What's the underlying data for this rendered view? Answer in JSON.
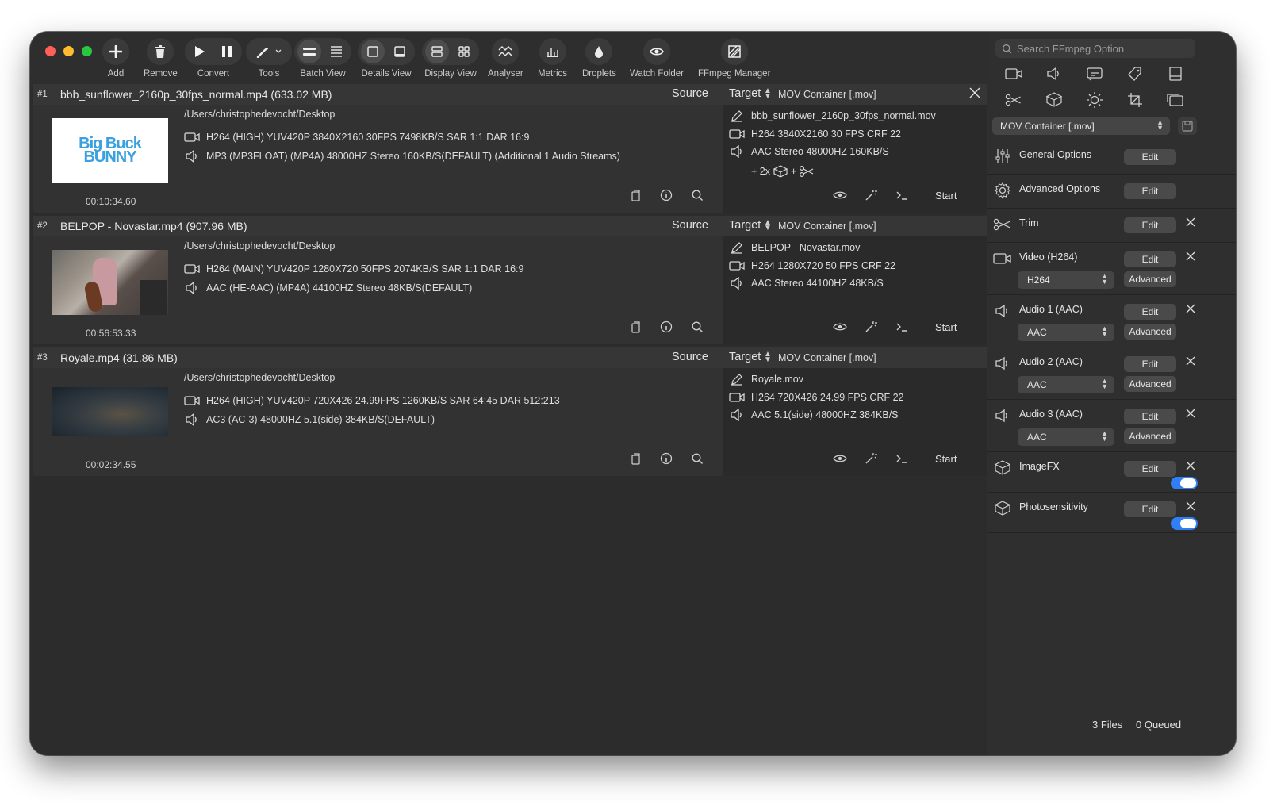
{
  "toolbar": {
    "items": [
      {
        "label": "Add",
        "icon": "plus-icon"
      },
      {
        "label": "Remove",
        "icon": "trash-icon"
      },
      {
        "label": "Convert",
        "icons": [
          "play-icon",
          "pause-icon"
        ]
      },
      {
        "label": "Tools",
        "icon": "wand-icon"
      },
      {
        "label": "Batch View",
        "icons": [
          "batch-list-icon",
          "batch-detail-list-icon"
        ]
      },
      {
        "label": "Details View",
        "icons": [
          "details-view-icon",
          "details-view-alt-icon"
        ]
      },
      {
        "label": "Display View",
        "icons": [
          "rows-icon",
          "grid-icon"
        ]
      },
      {
        "label": "Analyser",
        "icon": "analyser-icon"
      },
      {
        "label": "Metrics",
        "icon": "metrics-icon"
      },
      {
        "label": "Droplets",
        "icon": "droplet-icon"
      },
      {
        "label": "Watch Folder",
        "icon": "eye-icon"
      },
      {
        "label": "FFmpeg Manager",
        "icon": "ffmpeg-icon"
      }
    ]
  },
  "jobs": [
    {
      "number": "#1",
      "title": "bbb_sunflower_2160p_30fps_normal.mp4  (633.02 MB)",
      "source_label": "Source",
      "target_label": "Target",
      "target_container": "MOV Container [.mov]",
      "path": "/Users/christophedevocht/Desktop",
      "video_stream": "H264 (HIGH) YUV420P 3840X2160  30FPS 7498KB/S SAR 1:1 DAR 16:9",
      "audio_stream": "MP3 (MP3FLOAT) (MP4A) 48000HZ Stereo 160KB/S(DEFAULT) (Additional 1 Audio Streams)",
      "duration": "00:10:34.60",
      "thumb_text": "Big Buck BUNNY",
      "target_filename": "bbb_sunflower_2160p_30fps_normal.mov",
      "target_video": "H264 3840X2160 30 FPS CRF 22",
      "target_audio": "AAC Stereo 48000HZ 160KB/S",
      "target_extra": "+ 2x",
      "target_extra_plus": "+",
      "start_label": "Start"
    },
    {
      "number": "#2",
      "title": "BELPOP  - Novastar.mp4  (907.96 MB)",
      "source_label": "Source",
      "target_label": "Target",
      "target_container": "MOV Container [.mov]",
      "path": "/Users/christophedevocht/Desktop",
      "video_stream": "H264 (MAIN) YUV420P 1280X720  50FPS 2074KB/S SAR 1:1 DAR 16:9",
      "audio_stream": "AAC (HE-AAC) (MP4A) 44100HZ Stereo 48KB/S(DEFAULT)",
      "duration": "00:56:53.33",
      "target_filename": "BELPOP  - Novastar.mov",
      "target_video": "H264 1280X720 50 FPS CRF 22",
      "target_audio": "AAC Stereo 44100HZ 48KB/S",
      "start_label": "Start"
    },
    {
      "number": "#3",
      "title": "Royale.mp4  (31.86 MB)",
      "source_label": "Source",
      "target_label": "Target",
      "target_container": "MOV Container [.mov]",
      "path": "/Users/christophedevocht/Desktop",
      "video_stream": "H264 (HIGH) YUV420P 720X426  24.99FPS 1260KB/S SAR 64:45 DAR 512:213",
      "audio_stream": "AC3 (AC-3) 48000HZ 5.1(side) 384KB/S(DEFAULT)",
      "duration": "00:02:34.55",
      "target_filename": "Royale.mov",
      "target_video": "H264 720X426 24.99 FPS CRF 22",
      "target_audio": "AAC 5.1(side) 48000HZ 384KB/S",
      "start_label": "Start"
    }
  ],
  "sidebar": {
    "search_placeholder": "Search FFmpeg Option",
    "container_select": "MOV Container [.mov]",
    "sections": [
      {
        "title": "General Options",
        "edit": "Edit"
      },
      {
        "title": "Advanced Options",
        "edit": "Edit"
      },
      {
        "title": "Trim",
        "edit": "Edit"
      },
      {
        "title": "Video (H264)",
        "edit": "Edit",
        "codec": "H264",
        "advanced": "Advanced"
      },
      {
        "title": "Audio 1 (AAC)",
        "edit": "Edit",
        "codec": "AAC",
        "advanced": "Advanced"
      },
      {
        "title": "Audio 2 (AAC)",
        "edit": "Edit",
        "codec": "AAC",
        "advanced": "Advanced"
      },
      {
        "title": "Audio 3 (AAC)",
        "edit": "Edit",
        "codec": "AAC",
        "advanced": "Advanced"
      },
      {
        "title": "ImageFX",
        "edit": "Edit",
        "enabled": true
      },
      {
        "title": "Photosensitivity",
        "edit": "Edit",
        "enabled": true
      }
    ],
    "status_files": "3 Files",
    "status_queued": "0 Queued"
  },
  "colors": {
    "window_bg": "#2c2c2c",
    "sidebar_bg": "#2f2f2f",
    "toggle_accent": "#2f7ff5",
    "thumb_text": "#3aa0e0"
  }
}
